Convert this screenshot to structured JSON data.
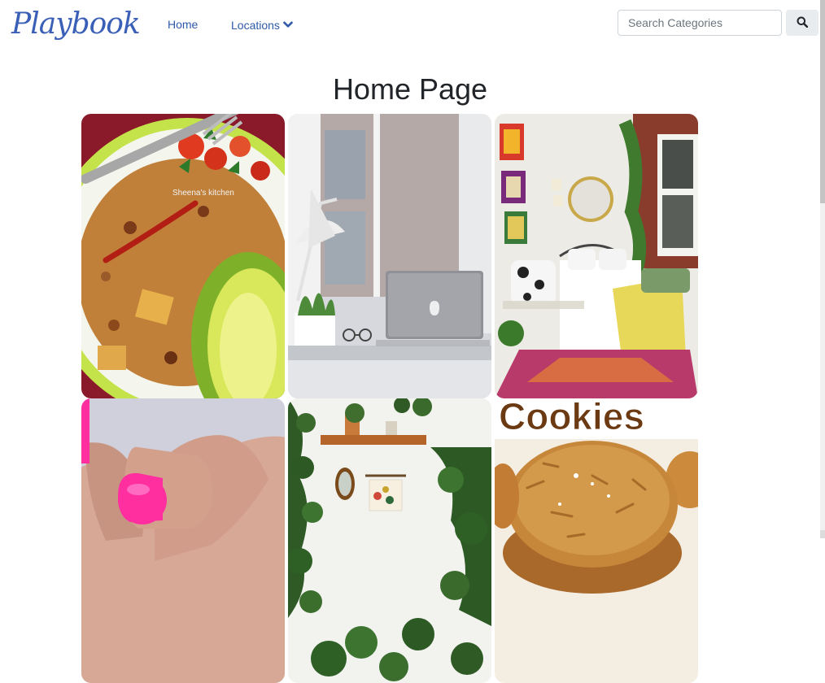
{
  "brand": {
    "name": "Playbook"
  },
  "nav": {
    "home_label": "Home",
    "locations_label": "Locations"
  },
  "search": {
    "placeholder": "Search Categories"
  },
  "page": {
    "title": "Home Page"
  },
  "cards": [
    {
      "image_caption": "Sheena's kitchen"
    },
    {
      "image_caption": ""
    },
    {
      "image_caption": ""
    },
    {
      "image_caption": ""
    },
    {
      "image_caption": ""
    },
    {
      "image_caption": "Cookies"
    }
  ],
  "colors": {
    "brand": "#3a5fb7",
    "link": "#2f5aa8",
    "button_bg": "#e9ecef"
  }
}
